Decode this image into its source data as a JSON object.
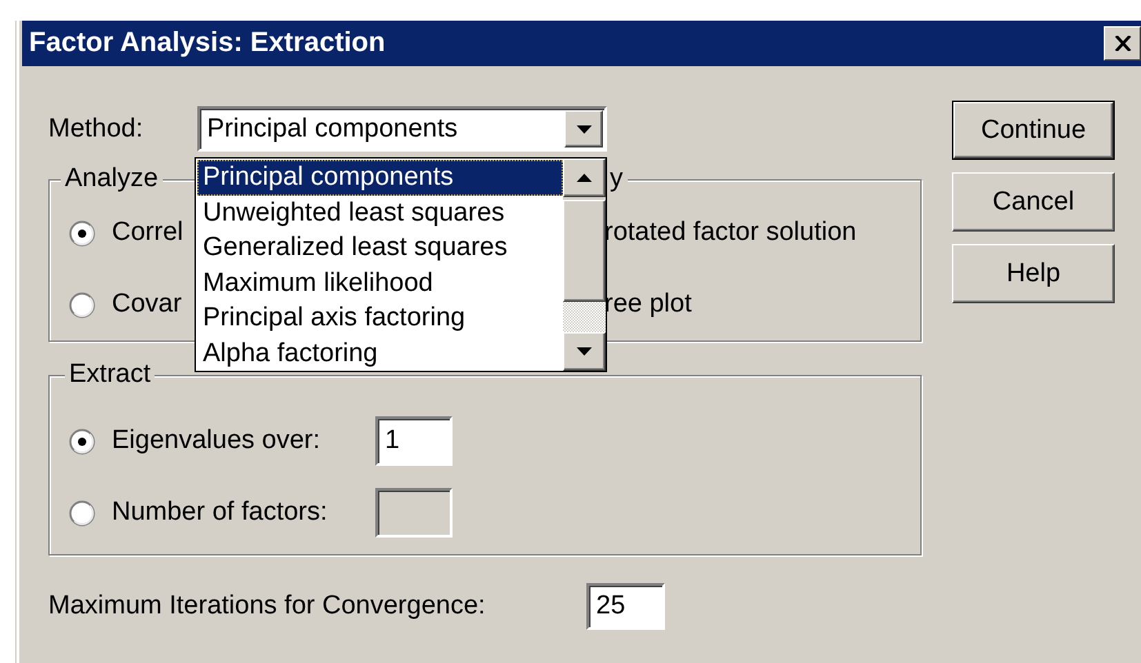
{
  "window": {
    "title": "Factor Analysis: Extraction"
  },
  "method": {
    "label": "Method:",
    "value": "Principal components",
    "expanded": true,
    "options": [
      {
        "label": "Principal components",
        "selected": true
      },
      {
        "label": "Unweighted least squares",
        "selected": false
      },
      {
        "label": "Generalized least squares",
        "selected": false
      },
      {
        "label": "Maximum likelihood",
        "selected": false
      },
      {
        "label": "Principal axis factoring",
        "selected": false
      },
      {
        "label": "Alpha factoring",
        "selected": false
      }
    ]
  },
  "analyze": {
    "legend": "Analyze",
    "options": [
      {
        "label": "Correl",
        "selected": true
      },
      {
        "label": "Covar",
        "selected": false
      }
    ]
  },
  "display": {
    "legend": "y",
    "items": [
      {
        "label": "rotated factor solution"
      },
      {
        "label": "ree plot"
      }
    ]
  },
  "extract": {
    "legend": "Extract",
    "options": [
      {
        "label": "Eigenvalues over:",
        "selected": true,
        "value": "1",
        "disabled": false
      },
      {
        "label": "Number of factors:",
        "selected": false,
        "disabled": true
      }
    ]
  },
  "iterations": {
    "label": "Maximum Iterations for Convergence:",
    "value": "25"
  },
  "buttons": [
    {
      "label": "Continue",
      "default": true
    },
    {
      "label": "Cancel",
      "default": false
    },
    {
      "label": "Help",
      "default": false
    }
  ]
}
